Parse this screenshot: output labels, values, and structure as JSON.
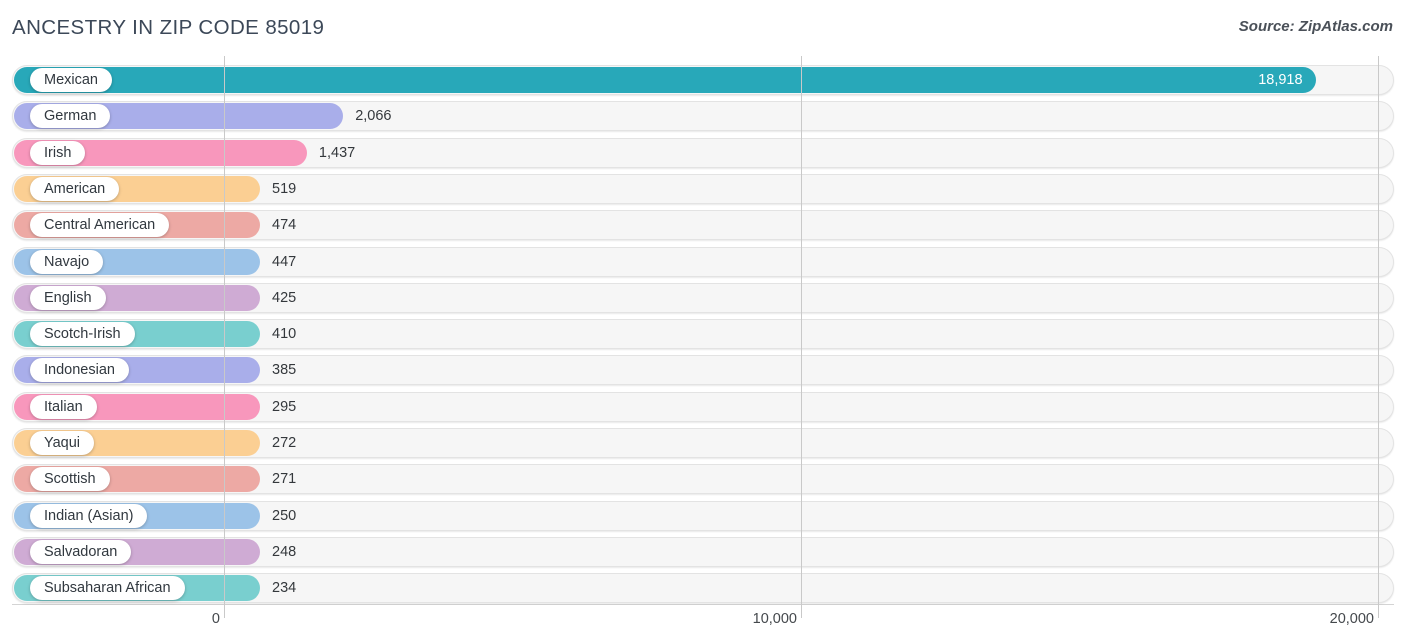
{
  "header": {
    "title": "ANCESTRY IN ZIP CODE 85019",
    "source": "Source: ZipAtlas.com"
  },
  "axis": {
    "ticks": [
      {
        "label": "0",
        "value": 0
      },
      {
        "label": "10,000",
        "value": 10000
      },
      {
        "label": "20,000",
        "value": 20000
      }
    ]
  },
  "chart_data": {
    "type": "bar",
    "orientation": "horizontal",
    "title": "ANCESTRY IN ZIP CODE 85019",
    "xlabel": "",
    "ylabel": "",
    "xlim": [
      0,
      20000
    ],
    "grid": true,
    "legend": false,
    "source": "Source: ZipAtlas.com",
    "categories": [
      "Mexican",
      "German",
      "Irish",
      "American",
      "Central American",
      "Navajo",
      "English",
      "Scotch-Irish",
      "Indonesian",
      "Italian",
      "Yaqui",
      "Scottish",
      "Indian (Asian)",
      "Salvadoran",
      "Subsaharan African"
    ],
    "values": [
      18918,
      2066,
      1437,
      519,
      474,
      447,
      425,
      410,
      385,
      295,
      272,
      271,
      250,
      248,
      234
    ],
    "value_labels": [
      "18,918",
      "2,066",
      "1,437",
      "519",
      "474",
      "447",
      "425",
      "410",
      "385",
      "295",
      "272",
      "271",
      "250",
      "248",
      "234"
    ],
    "colors": [
      "#28a8b9",
      "#a9aeea",
      "#f897bc",
      "#fbcf93",
      "#eda9a4",
      "#9cc3e8",
      "#cfabd4",
      "#79cfcf",
      "#a9aeea",
      "#f897bc",
      "#fbcf93",
      "#eda9a4",
      "#9cc3e8",
      "#cfabd4",
      "#79cfcf"
    ]
  }
}
